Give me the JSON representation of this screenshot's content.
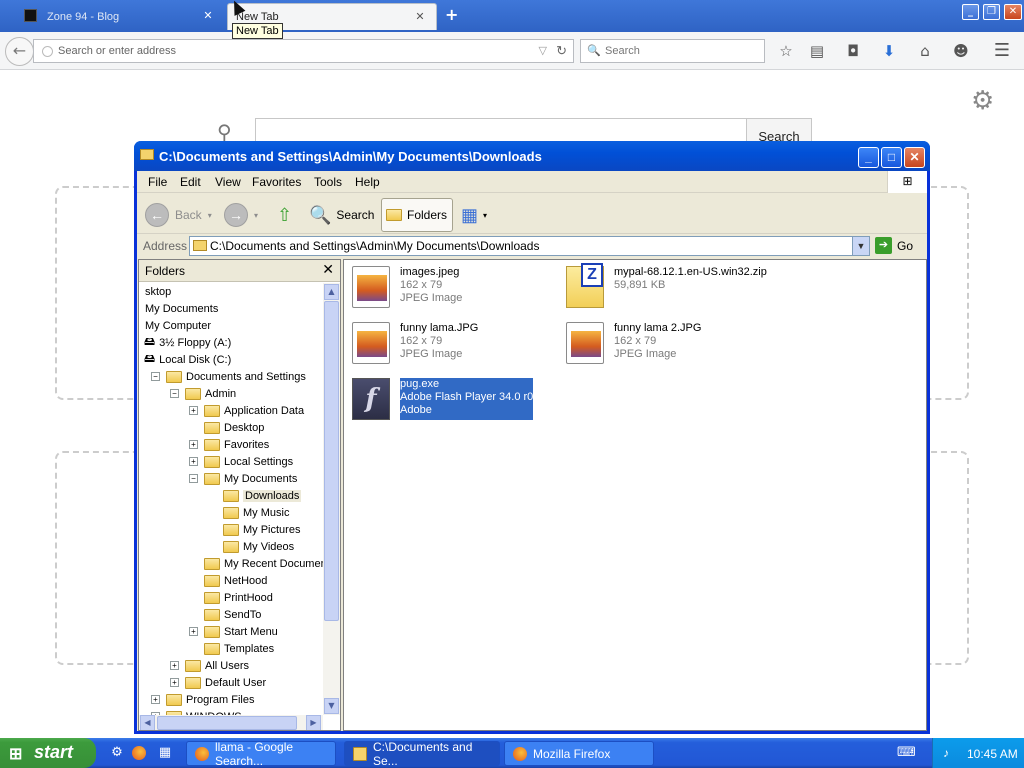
{
  "browser": {
    "tabs": [
      {
        "title": "Zone 94 - Blog",
        "active": false
      },
      {
        "title": "New Tab",
        "active": true
      }
    ],
    "tooltip": "New Tab",
    "url_placeholder": "Search or enter address",
    "search_placeholder": "Search",
    "newtab_search_button": "Search",
    "icons": [
      "back-icon",
      "reload-icon",
      "search-icon",
      "bookmark-star-icon",
      "reading-list-icon",
      "pocket-icon",
      "download-icon",
      "home-icon",
      "hello-icon",
      "menu-icon",
      "gear-icon",
      "new-tab-icon"
    ]
  },
  "explorer": {
    "title": "C:\\Documents and Settings\\Admin\\My Documents\\Downloads",
    "menu": [
      "File",
      "Edit",
      "View",
      "Favorites",
      "Tools",
      "Help"
    ],
    "toolbar": {
      "back": "Back",
      "search": "Search",
      "folders": "Folders"
    },
    "address_label": "Address",
    "address_value": "C:\\Documents and Settings\\Admin\\My Documents\\Downloads",
    "go_label": "Go",
    "folders_header": "Folders",
    "tree": [
      {
        "label": "sktop",
        "level": 0,
        "expander": "none"
      },
      {
        "label": "My Documents",
        "level": 0,
        "expander": "none"
      },
      {
        "label": "My Computer",
        "level": 0,
        "expander": "none"
      },
      {
        "label": "3½ Floppy (A:)",
        "level": 1,
        "expander": "none"
      },
      {
        "label": "Local Disk (C:)",
        "level": 1,
        "expander": "none"
      },
      {
        "label": "Documents and Settings",
        "level": 2,
        "expander": "minus"
      },
      {
        "label": "Admin",
        "level": 3,
        "expander": "minus"
      },
      {
        "label": "Application Data",
        "level": 4,
        "expander": "plus"
      },
      {
        "label": "Desktop",
        "level": 4,
        "expander": "none"
      },
      {
        "label": "Favorites",
        "level": 4,
        "expander": "plus"
      },
      {
        "label": "Local Settings",
        "level": 4,
        "expander": "plus"
      },
      {
        "label": "My Documents",
        "level": 4,
        "expander": "minus"
      },
      {
        "label": "Downloads",
        "level": 5,
        "expander": "none",
        "selected": true
      },
      {
        "label": "My Music",
        "level": 5,
        "expander": "none"
      },
      {
        "label": "My Pictures",
        "level": 5,
        "expander": "none"
      },
      {
        "label": "My Videos",
        "level": 5,
        "expander": "none"
      },
      {
        "label": "My Recent Documents",
        "level": 4,
        "expander": "none"
      },
      {
        "label": "NetHood",
        "level": 4,
        "expander": "none"
      },
      {
        "label": "PrintHood",
        "level": 4,
        "expander": "none"
      },
      {
        "label": "SendTo",
        "level": 4,
        "expander": "none"
      },
      {
        "label": "Start Menu",
        "level": 4,
        "expander": "plus"
      },
      {
        "label": "Templates",
        "level": 4,
        "expander": "none"
      },
      {
        "label": "All Users",
        "level": 3,
        "expander": "plus"
      },
      {
        "label": "Default User",
        "level": 3,
        "expander": "plus"
      },
      {
        "label": "Program Files",
        "level": 2,
        "expander": "plus"
      },
      {
        "label": "WINDOWS",
        "level": 2,
        "expander": "plus"
      }
    ],
    "files": [
      {
        "name": "images.jpeg",
        "line2": "162 x 79",
        "line3": "JPEG Image",
        "icon": "jpeg-icon",
        "selected": false
      },
      {
        "name": "mypal-68.12.1.en-US.win32.zip",
        "line2": "59,891 KB",
        "line3": "",
        "icon": "zip-icon",
        "selected": false
      },
      {
        "name": "funny lama.JPG",
        "line2": "162 x 79",
        "line3": "JPEG Image",
        "icon": "jpeg-icon",
        "selected": false
      },
      {
        "name": "funny lama 2.JPG",
        "line2": "162 x 79",
        "line3": "JPEG Image",
        "icon": "jpeg-icon",
        "selected": false
      },
      {
        "name": "pug.exe",
        "line2": "Adobe Flash Player 34.0 r0",
        "line3": "Adobe",
        "icon": "flash-icon",
        "selected": true
      }
    ]
  },
  "taskbar": {
    "start_label": "start",
    "tasks": [
      {
        "label": "llama - Google Search...",
        "icon": "firefox-icon",
        "active": false
      },
      {
        "label": "C:\\Documents and Se...",
        "icon": "folder-icon",
        "active": true
      },
      {
        "label": "Mozilla Firefox",
        "icon": "firefox-icon",
        "active": false
      }
    ],
    "clock": "10:45 AM"
  }
}
